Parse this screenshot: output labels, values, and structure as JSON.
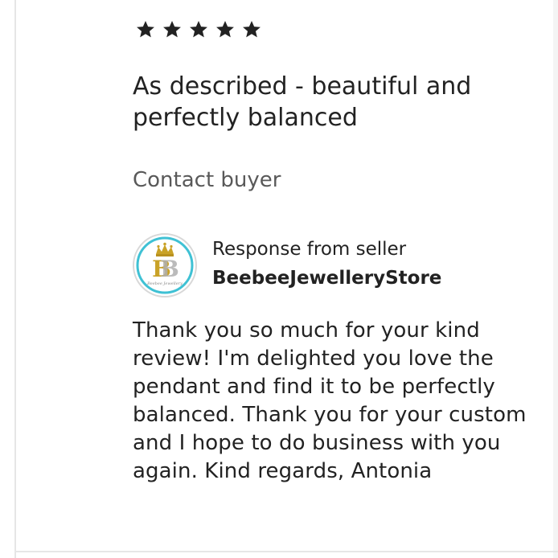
{
  "review": {
    "rating": 5,
    "rating_max": 5,
    "title": "As described - beautiful and perfectly balanced",
    "contact_label": "Contact buyer"
  },
  "response": {
    "label": "Response from seller",
    "shop_name": "BeebeeJewelleryStore",
    "avatar_monogram": "BB",
    "avatar_caption": "Beebee Jewellery",
    "text": "Thank you so much for your kind review! I'm delighted you love the pendant and find it to be perfectly balanced. Thank you for your custom and I hope to do business with you again. Kind regards, Antonia"
  },
  "colors": {
    "text": "#222222",
    "muted": "#595959",
    "gold": "#c9a227",
    "teal": "#3fc1d4",
    "border": "#e6e6e6"
  },
  "icons": {
    "star": "star-icon",
    "avatar": "crown-logo-icon"
  }
}
